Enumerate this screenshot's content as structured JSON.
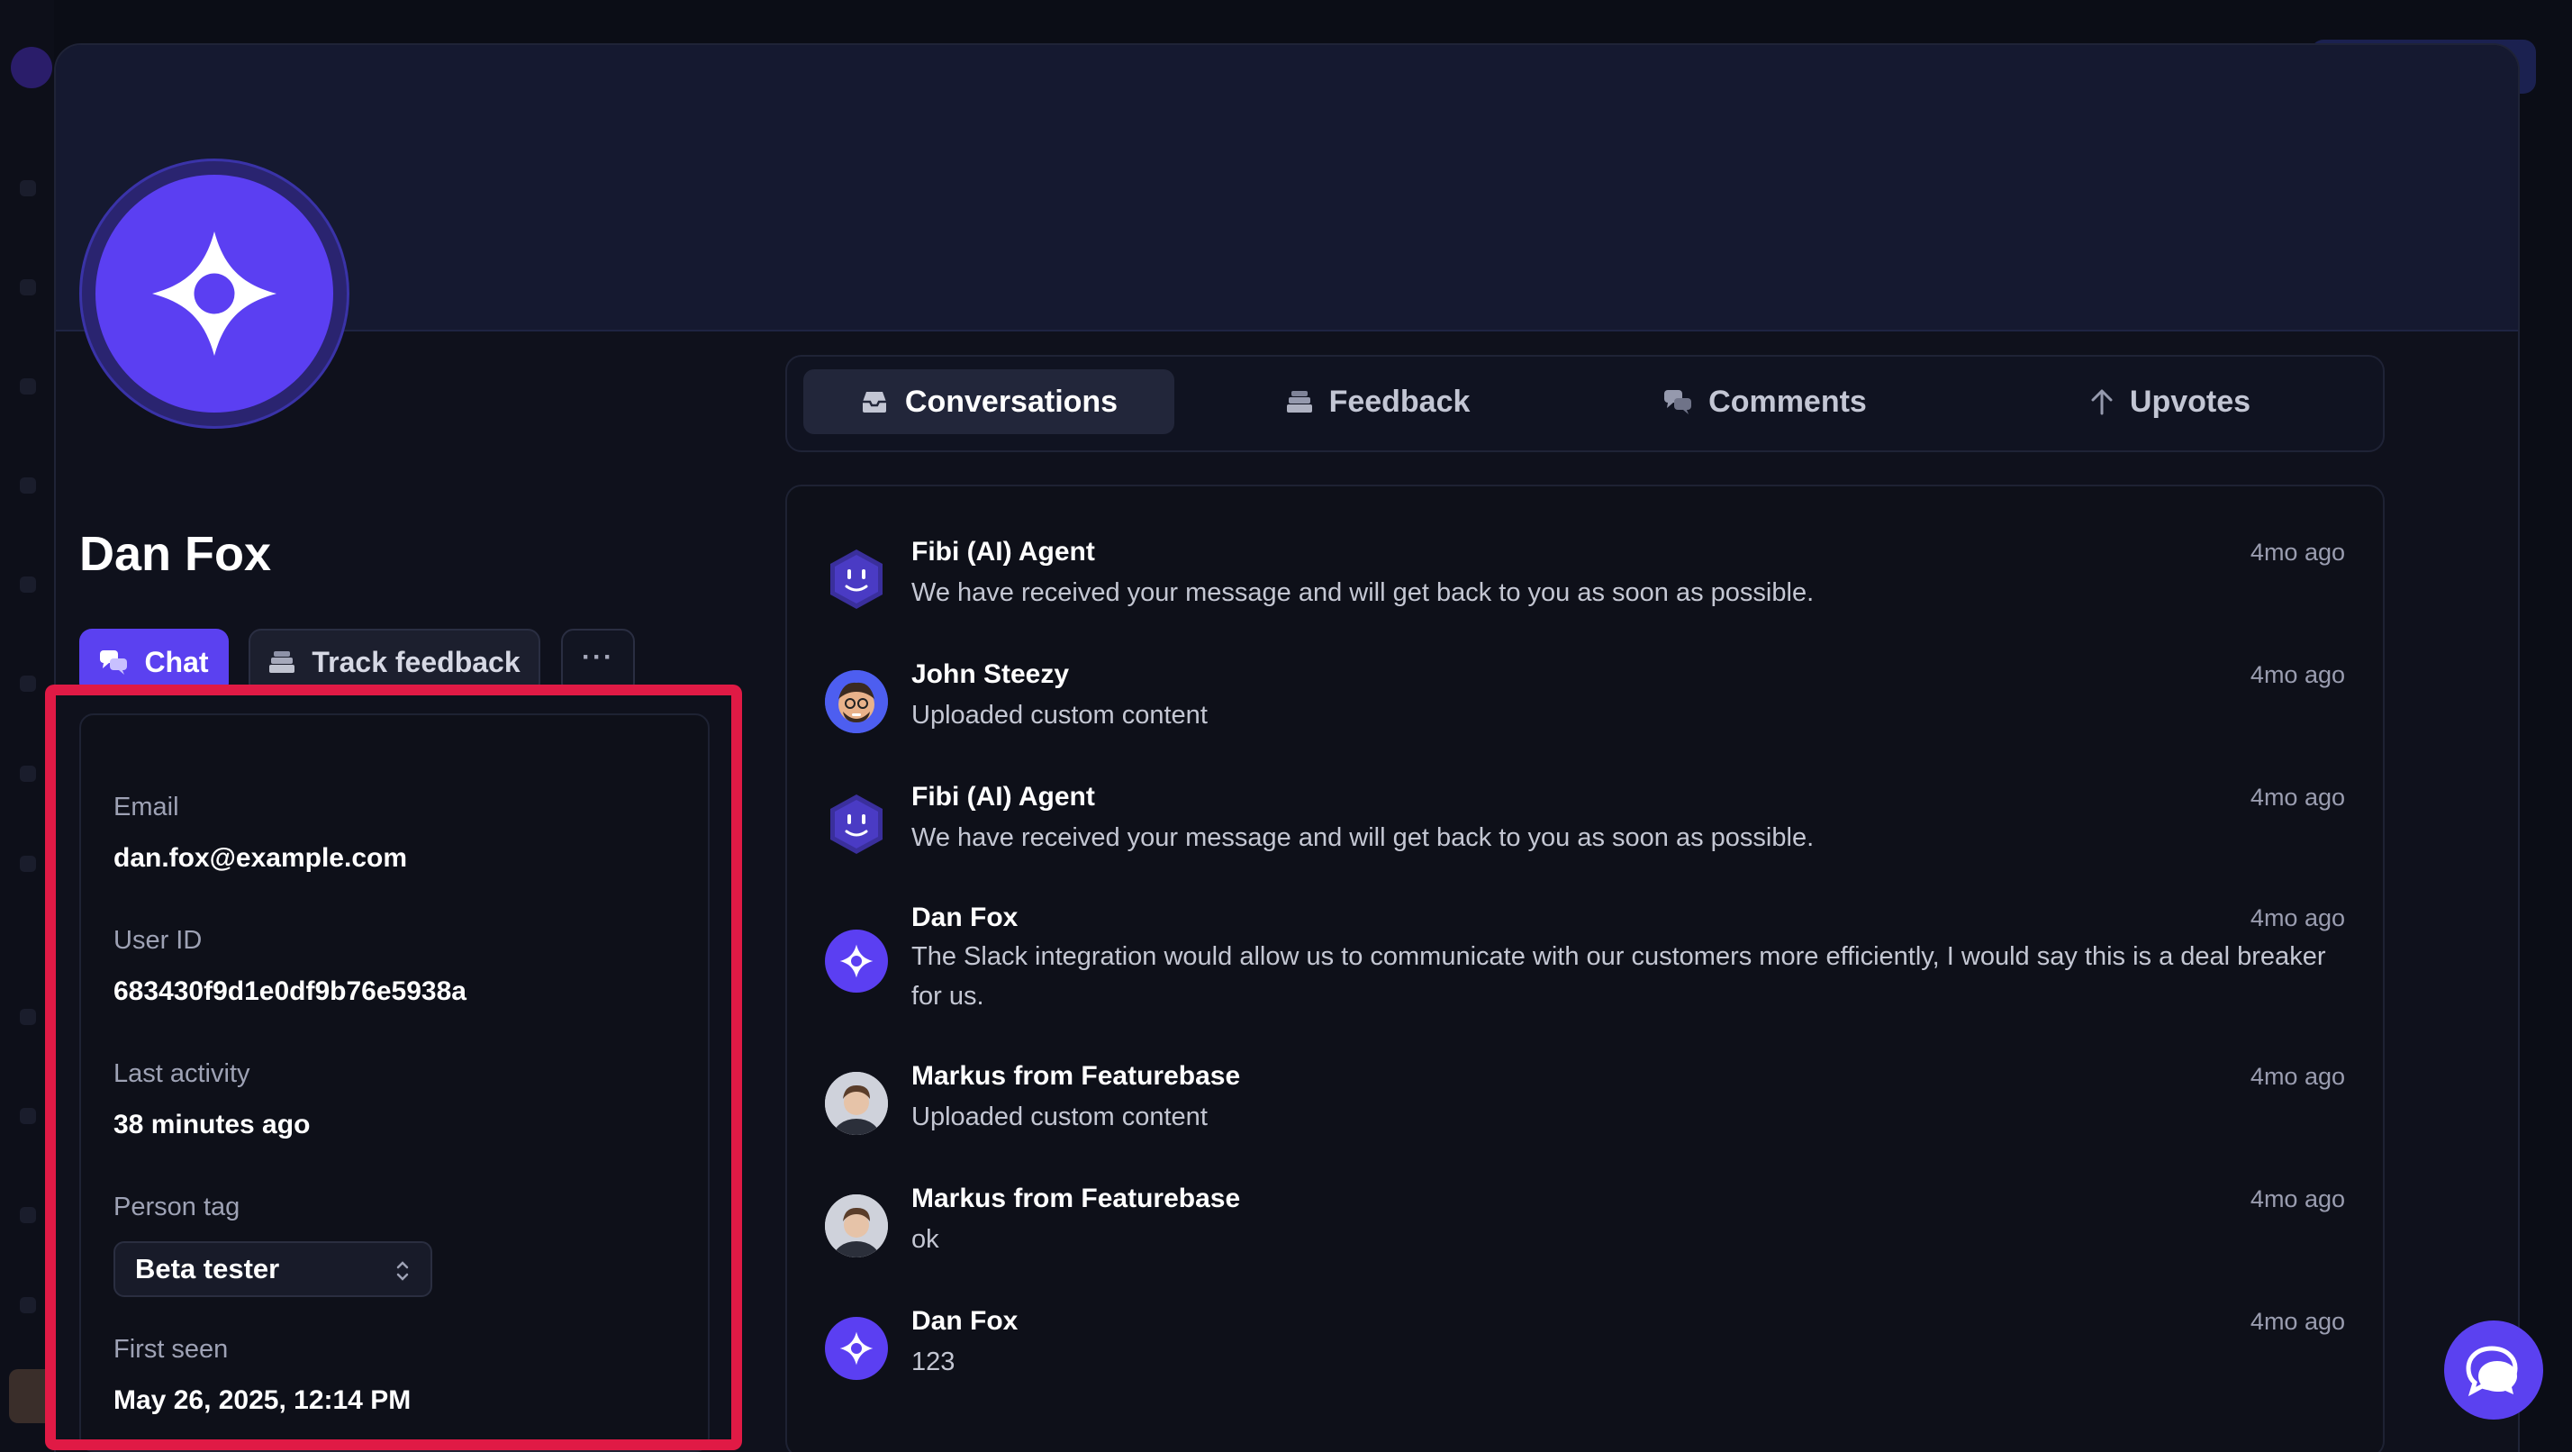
{
  "user": {
    "name": "Dan Fox"
  },
  "actions": {
    "chat_label": "Chat",
    "track_label": "Track feedback",
    "more_label": "···"
  },
  "details": {
    "email_label": "Email",
    "email_value": "dan.fox@example.com",
    "userid_label": "User ID",
    "userid_value": "683430f9d1e0df9b76e5938a",
    "activity_label": "Last activity",
    "activity_value": "38 minutes ago",
    "tag_label": "Person tag",
    "tag_value": "Beta tester",
    "firstseen_label": "First seen",
    "firstseen_value": "May 26, 2025, 12:14 PM"
  },
  "tabs": [
    {
      "label": "Conversations",
      "icon": "inbox-icon",
      "active": true
    },
    {
      "label": "Feedback",
      "icon": "stack-icon",
      "active": false
    },
    {
      "label": "Comments",
      "icon": "chat-bubbles-icon",
      "active": false
    },
    {
      "label": "Upvotes",
      "icon": "arrow-up-icon",
      "active": false
    }
  ],
  "conversations": [
    {
      "author": "Fibi (AI) Agent",
      "message": "We have received your message and will get back to you as soon as possible.",
      "time": "4mo ago",
      "avatar": "fibi"
    },
    {
      "author": "John Steezy",
      "message": "Uploaded custom content",
      "time": "4mo ago",
      "avatar": "john"
    },
    {
      "author": "Fibi (AI) Agent",
      "message": "We have received your message and will get back to you as soon as possible.",
      "time": "4mo ago",
      "avatar": "fibi"
    },
    {
      "author": "Dan Fox",
      "message": "The Slack integration would allow us to communicate with our customers more efficiently, I would say this is a deal breaker for us.",
      "time": "4mo ago",
      "avatar": "dan"
    },
    {
      "author": "Markus from Featurebase",
      "message": "Uploaded custom content",
      "time": "4mo ago",
      "avatar": "markus"
    },
    {
      "author": "Markus from Featurebase",
      "message": "ok",
      "time": "4mo ago",
      "avatar": "markus"
    },
    {
      "author": "Dan Fox",
      "message": "123",
      "time": "4mo ago",
      "avatar": "dan"
    }
  ],
  "colors": {
    "accent": "#5b41f0",
    "highlight": "#e01a45",
    "panel": "#121525"
  }
}
